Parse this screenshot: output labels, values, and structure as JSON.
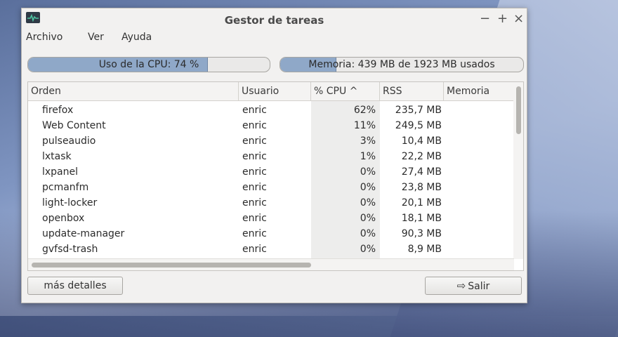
{
  "window": {
    "title": "Gestor de tareas",
    "controls": {
      "minimize": "−",
      "maximize": "+",
      "close": "×"
    }
  },
  "menu": [
    "Archivo",
    "Ver",
    "Ayuda"
  ],
  "cpu": {
    "label": "Uso de la CPU: 74 %",
    "percent": 74
  },
  "memory": {
    "label": "Memoria: 439 MB de 1923 MB usados",
    "used_mb": 439,
    "total_mb": 1923
  },
  "table": {
    "columns": [
      "Orden",
      "Usuario",
      "% CPU ^",
      "RSS",
      "Memoria"
    ],
    "sorted_by": "% CPU",
    "rows": [
      {
        "name": "firefox",
        "user": "enric",
        "cpu": "62%",
        "rss": "235,7 MB"
      },
      {
        "name": "Web Content",
        "user": "enric",
        "cpu": "11%",
        "rss": "249,5 MB"
      },
      {
        "name": "pulseaudio",
        "user": "enric",
        "cpu": "3%",
        "rss": "10,4 MB"
      },
      {
        "name": "lxtask",
        "user": "enric",
        "cpu": "1%",
        "rss": "22,2 MB"
      },
      {
        "name": "lxpanel",
        "user": "enric",
        "cpu": "0%",
        "rss": "27,4 MB"
      },
      {
        "name": "pcmanfm",
        "user": "enric",
        "cpu": "0%",
        "rss": "23,8 MB"
      },
      {
        "name": "light-locker",
        "user": "enric",
        "cpu": "0%",
        "rss": "20,1 MB"
      },
      {
        "name": "openbox",
        "user": "enric",
        "cpu": "0%",
        "rss": "18,1 MB"
      },
      {
        "name": "update-manager",
        "user": "enric",
        "cpu": "0%",
        "rss": "90,3 MB"
      },
      {
        "name": "gvfsd-trash",
        "user": "enric",
        "cpu": "0%",
        "rss": "8,9 MB"
      }
    ]
  },
  "buttons": {
    "details": "más detalles",
    "exit": "Salir"
  },
  "icons": {
    "app": "task-manager-icon",
    "exit": "exit-icon"
  }
}
